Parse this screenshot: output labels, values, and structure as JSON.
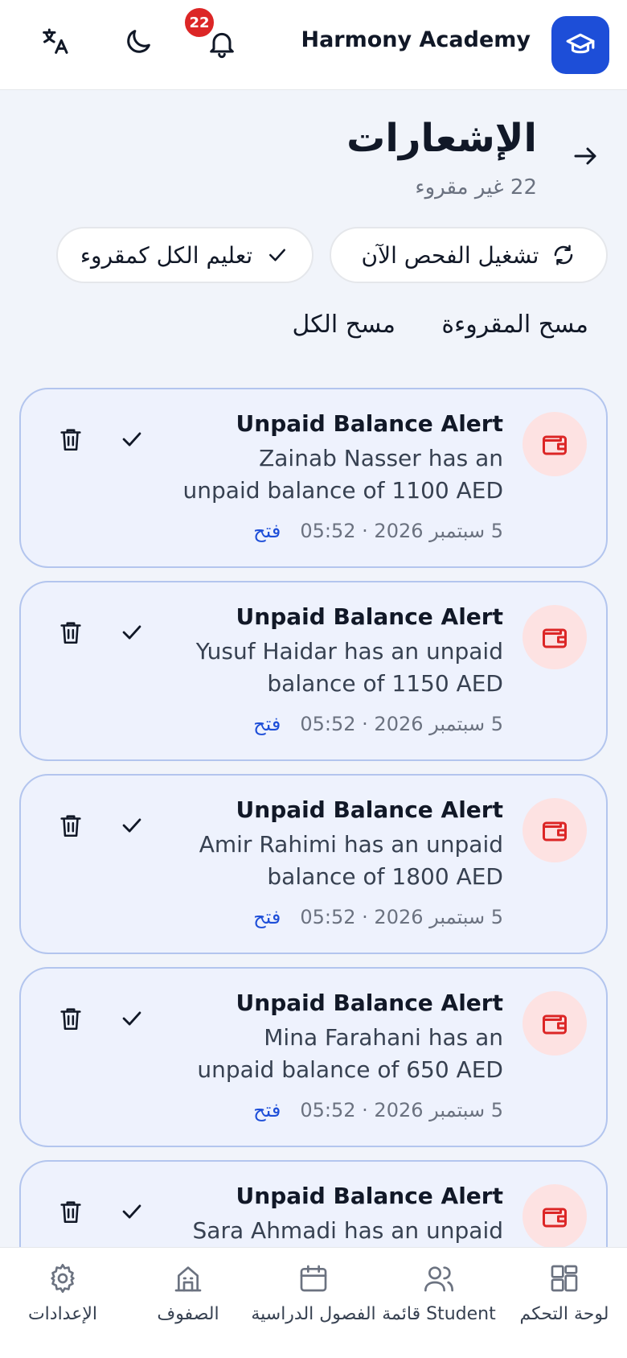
{
  "header": {
    "brand_name": "Harmony Academy",
    "notification_count": "22",
    "icons": [
      "translate-icon",
      "moon-icon",
      "bell-icon",
      "graduation-cap-icon"
    ]
  },
  "page": {
    "title": "الإشعارات",
    "unread_count": "22 غير مقروء"
  },
  "actions": {
    "scan_now": "تشغيل الفحص الآن",
    "mark_all_read": "تعليم الكل كمقروء",
    "clear_read": "مسح المقروءة",
    "clear_all": "مسح الكل"
  },
  "notifications": [
    {
      "title": "Unpaid Balance Alert",
      "message": "Zainab Nasser has an unpaid balance of 1100 AED",
      "time": "5 سبتمبر 2026 · 05:52",
      "open": "فتح"
    },
    {
      "title": "Unpaid Balance Alert",
      "message": "Yusuf Haidar has an unpaid balance of 1150 AED",
      "time": "5 سبتمبر 2026 · 05:52",
      "open": "فتح"
    },
    {
      "title": "Unpaid Balance Alert",
      "message": "Amir Rahimi has an unpaid balance of 1800 AED",
      "time": "5 سبتمبر 2026 · 05:52",
      "open": "فتح"
    },
    {
      "title": "Unpaid Balance Alert",
      "message": "Mina Farahani has an unpaid balance of 650 AED",
      "time": "5 سبتمبر 2026 · 05:52",
      "open": "فتح"
    },
    {
      "title": "Unpaid Balance Alert",
      "message": "Sara Ahmadi has an unpaid",
      "time": "",
      "open": ""
    }
  ],
  "bottom_nav": [
    {
      "label": "لوحة التحكم",
      "icon": "dashboard-icon"
    },
    {
      "label": "قائمة Student",
      "icon": "users-icon"
    },
    {
      "label": "الفصول الدراسية",
      "icon": "calendar-icon"
    },
    {
      "label": "الصفوف",
      "icon": "building-icon"
    },
    {
      "label": "الإعدادات",
      "icon": "gear-icon"
    }
  ],
  "colors": {
    "accent": "#1d4ed8",
    "badge": "#dc2626",
    "card_bg": "#eef2fd",
    "card_border": "#b3c5ee",
    "alert_icon": "#dc2626"
  }
}
